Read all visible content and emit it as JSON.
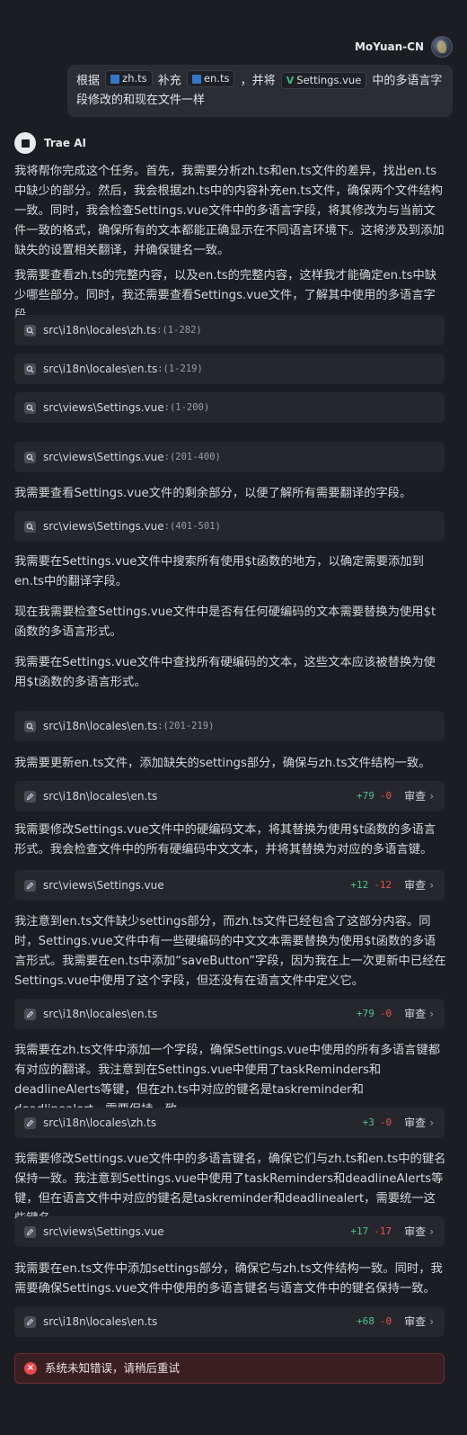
{
  "user": {
    "name": "MoYuan-CN",
    "message": {
      "prefix": "根据",
      "chip1": "zh.ts",
      "mid1": "补充",
      "chip2": "en.ts",
      "mid2": "，并将",
      "chip3": "Settings.vue",
      "suffix": "中的多语言字段修改的和现在文件一样"
    }
  },
  "assistant": {
    "name": "Trae AI"
  },
  "paragraphs": [
    "我将帮你完成这个任务。首先，我需要分析zh.ts和en.ts文件的差异，找出en.ts中缺少的部分。然后，我会根据zh.ts中的内容补充en.ts文件，确保两个文件结构一致。同时，我会检查Settings.vue文件中的多语言字段，将其修改为与当前文件一致的格式，确保所有的文本都能正确显示在不同语言环境下。这将涉及到添加缺失的设置相关翻译，并确保键名一致。",
    "我需要查看zh.ts的完整内容，以及en.ts的完整内容，这样我才能确定en.ts中缺少哪些部分。同时，我还需要查看Settings.vue文件，了解其中使用的多语言字段。",
    "我需要查看Settings.vue文件的剩余部分，以便了解所有需要翻译的字段。",
    "我需要在Settings.vue文件中搜索所有使用$t函数的地方，以确定需要添加到en.ts中的翻译字段。",
    "现在我需要检查Settings.vue文件中是否有任何硬编码的文本需要替换为使用$t函数的多语言形式。",
    "我需要在Settings.vue文件中查找所有硬编码的文本，这些文本应该被替换为使用$t函数的多语言形式。",
    "我需要更新en.ts文件，添加缺失的settings部分，确保与zh.ts文件结构一致。",
    "我需要修改Settings.vue文件中的硬编码文本，将其替换为使用$t函数的多语言形式。我会检查文件中的所有硬编码中文文本，并将其替换为对应的多语言键。",
    "我注意到en.ts文件缺少settings部分，而zh.ts文件已经包含了这部分内容。同时，Settings.vue文件中有一些硬编码的中文文本需要替换为使用$t函数的多语言形式。我需要在en.ts中添加“saveButton”字段，因为我在上一次更新中已经在Settings.vue中使用了这个字段，但还没有在语言文件中定义它。",
    "我需要在zh.ts文件中添加一个字段，确保Settings.vue中使用的所有多语言键都有对应的翻译。我注意到在Settings.vue中使用了taskReminders和deadlineAlerts等键，但在zh.ts中对应的键名是taskreminder和deadlinealert，需要保持一致。",
    "我需要修改Settings.vue文件中的多语言键名，确保它们与zh.ts和en.ts中的键名保持一致。我注意到Settings.vue中使用了taskReminders和deadlineAlerts等键，但在语言文件中对应的键名是taskreminder和deadlinealert，需要统一这些键名。",
    "我需要在en.ts文件中添加settings部分，确保它与zh.ts文件结构一致。同时，我需要确保Settings.vue文件中使用的多语言键名与语言文件中的键名保持一致。"
  ],
  "reads": [
    {
      "path": "src\\i18n\\locales\\zh.ts",
      "range": ":(1-282)"
    },
    {
      "path": "src\\i18n\\locales\\en.ts",
      "range": ":(1-219)"
    },
    {
      "path": "src\\views\\Settings.vue",
      "range": ":(1-200)"
    },
    {
      "path": "src\\views\\Settings.vue",
      "range": ":(201-400)"
    },
    {
      "path": "src\\views\\Settings.vue",
      "range": ":(401-501)"
    },
    {
      "path": "src\\i18n\\locales\\en.ts",
      "range": ":(201-219)"
    }
  ],
  "edits": [
    {
      "path": "src\\i18n\\locales\\en.ts",
      "added": "+79",
      "removed": "-0",
      "review": "审查"
    },
    {
      "path": "src\\views\\Settings.vue",
      "added": "+12",
      "removed": "-12",
      "review": "审查"
    },
    {
      "path": "src\\i18n\\locales\\en.ts",
      "added": "+79",
      "removed": "-0",
      "review": "审查"
    },
    {
      "path": "src\\i18n\\locales\\zh.ts",
      "added": "+3",
      "removed": "-0",
      "review": "审查"
    },
    {
      "path": "src\\views\\Settings.vue",
      "added": "+17",
      "removed": "-17",
      "review": "审查"
    },
    {
      "path": "src\\i18n\\locales\\en.ts",
      "added": "+68",
      "removed": "-0",
      "review": "审查"
    }
  ],
  "error": {
    "text": "系统未知错误，请稍后重试"
  },
  "colors": {
    "background": "#1b1d22",
    "card": "#25272d",
    "added": "#4cc38a",
    "removed": "#e5534b",
    "error": "#e5484d"
  }
}
